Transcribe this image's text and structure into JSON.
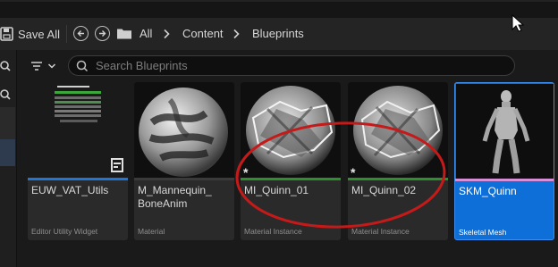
{
  "toolbar": {
    "save_all_label": "Save All",
    "breadcrumb": [
      "All",
      "Content",
      "Blueprints"
    ]
  },
  "search": {
    "placeholder": "Search Blueprints"
  },
  "assets": [
    {
      "name": "EUW_VAT_Utils",
      "type": "Editor Utility Widget",
      "bar_color": "#1d76d8",
      "selected": false
    },
    {
      "name": "M_Mannequin_\nBoneAnim",
      "type": "Material",
      "bar_color": "#3a3a3a",
      "selected": false
    },
    {
      "name": "MI_Quinn_01",
      "type": "Material Instance",
      "bar_color": "#2e8f2e",
      "selected": false
    },
    {
      "name": "MI_Quinn_02",
      "type": "Material Instance",
      "bar_color": "#2e8f2e",
      "selected": false
    },
    {
      "name": "SKM_Quinn",
      "type": "Skeletal Mesh",
      "bar_color": "#d78fd8",
      "selected": true
    }
  ],
  "colors": {
    "accent": "#0f6fd8",
    "annotation": "#c41a1a"
  }
}
